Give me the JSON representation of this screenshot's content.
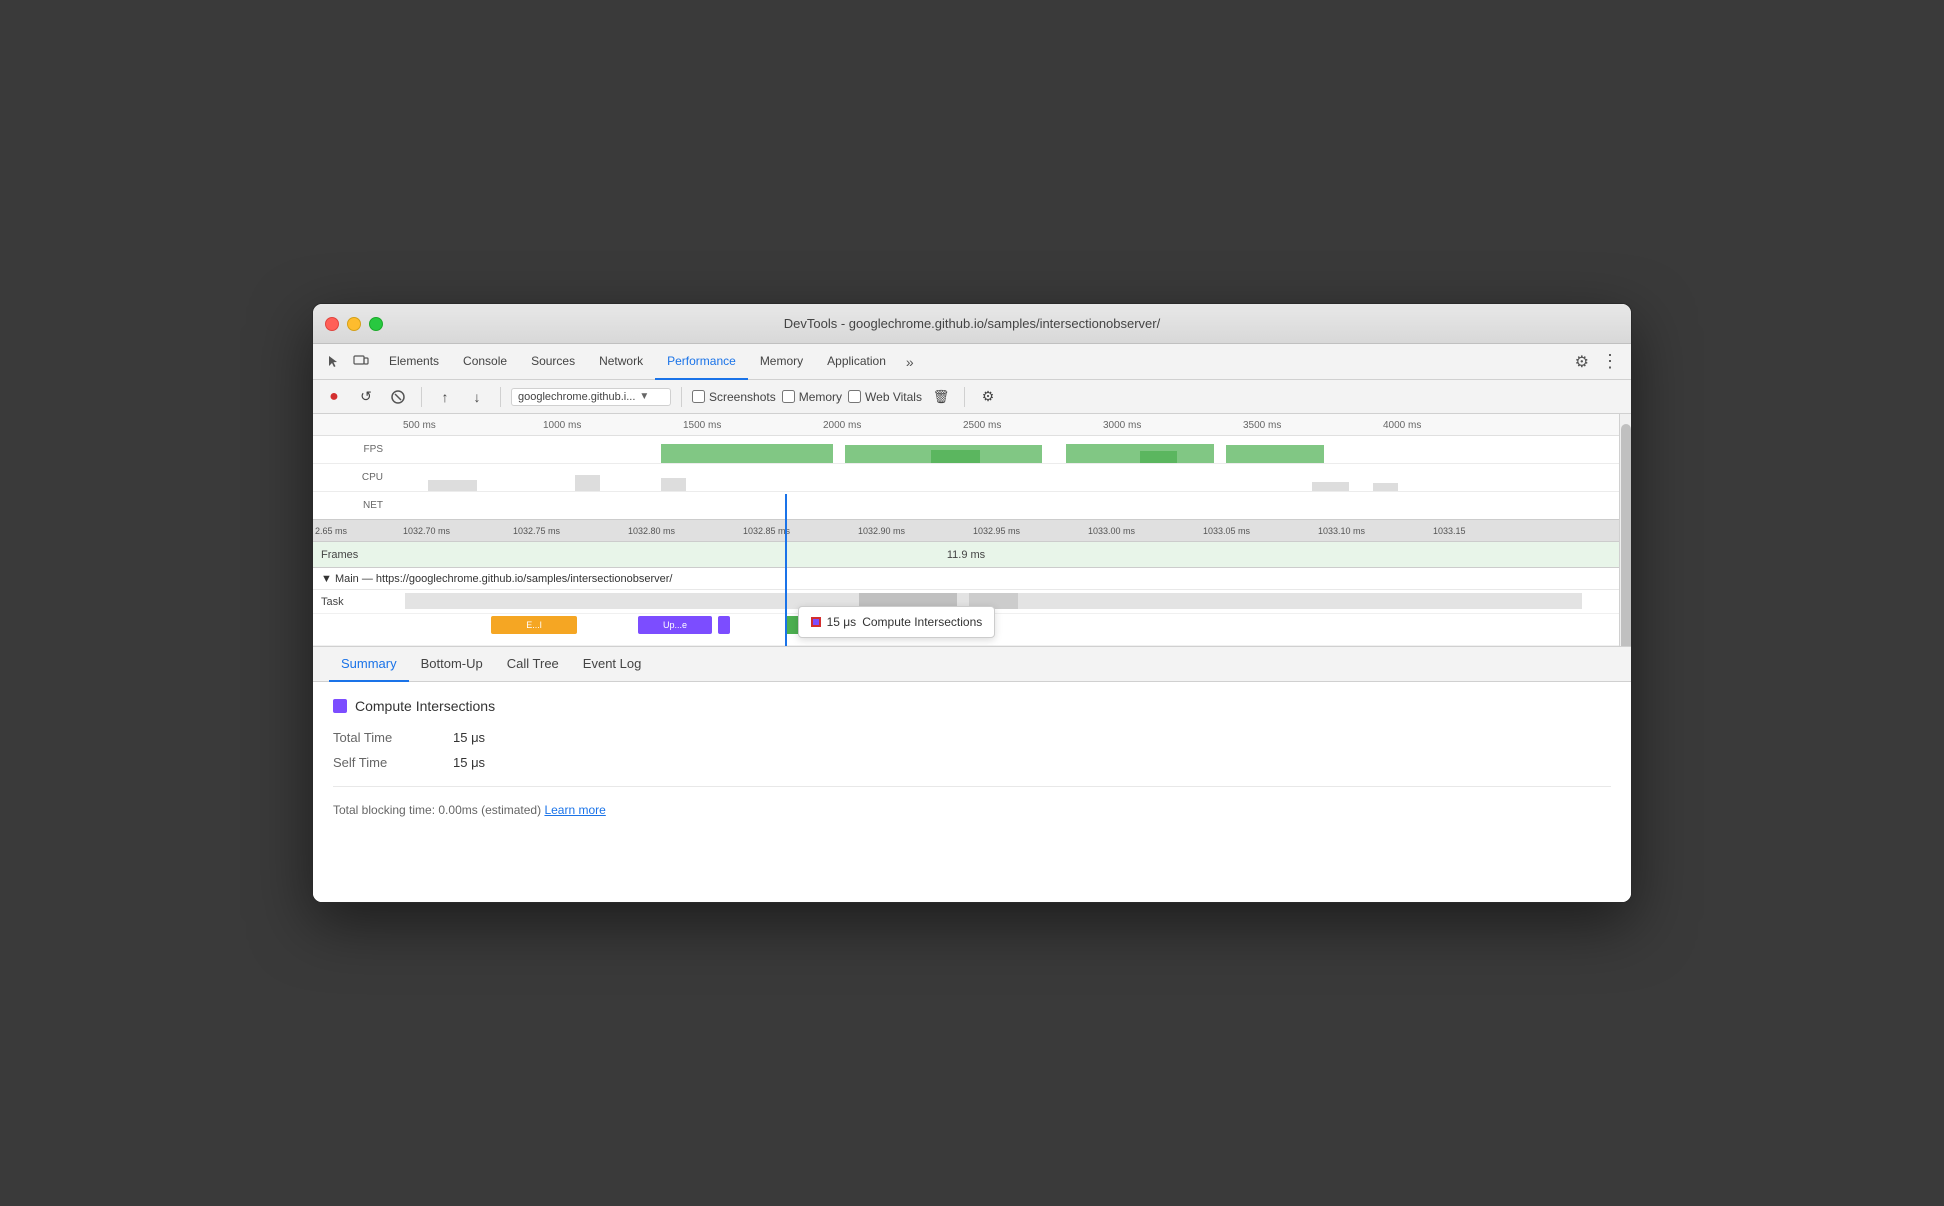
{
  "window": {
    "title": "DevTools - googlechrome.github.io/samples/intersectionobserver/"
  },
  "nav": {
    "tabs": [
      {
        "id": "elements",
        "label": "Elements",
        "active": false
      },
      {
        "id": "console",
        "label": "Console",
        "active": false
      },
      {
        "id": "sources",
        "label": "Sources",
        "active": false
      },
      {
        "id": "network",
        "label": "Network",
        "active": false
      },
      {
        "id": "performance",
        "label": "Performance",
        "active": true
      },
      {
        "id": "memory",
        "label": "Memory",
        "active": false
      },
      {
        "id": "application",
        "label": "Application",
        "active": false
      }
    ],
    "more_label": "»",
    "settings_icon": "⚙",
    "dots_icon": "⋮"
  },
  "toolbar": {
    "record_label": "●",
    "refresh_label": "↺",
    "stop_label": "⊘",
    "upload_label": "↑",
    "download_label": "↓",
    "url_text": "googlechrome.github.i...",
    "screenshots_label": "Screenshots",
    "memory_label": "Memory",
    "web_vitals_label": "Web Vitals",
    "trash_label": "🗑",
    "settings_label": "⚙"
  },
  "timeline": {
    "ruler_marks": [
      "500 ms",
      "1000 ms",
      "1500 ms",
      "2000 ms",
      "2500 ms",
      "3000 ms",
      "3500 ms",
      "4000 ms"
    ],
    "fps_label": "FPS",
    "cpu_label": "CPU",
    "net_label": "NET",
    "ms_marks": [
      "2.65 ms",
      "1032.70 ms",
      "1032.75 ms",
      "1032.80 ms",
      "1032.85 ms",
      "1032.90 ms",
      "1032.95 ms",
      "1033.00 ms",
      "1033.05 ms",
      "1033.10 ms",
      "1033.15"
    ],
    "frames_label": "Frames",
    "frames_value": "11.9 ms",
    "main_label": "▼ Main — https://googlechrome.github.io/samples/intersectionobserver/",
    "task_label": "Task",
    "task_blocks": [
      {
        "label": "E...l",
        "color": "#f5a623",
        "left": "12%",
        "width": "7%"
      },
      {
        "label": "Up...e",
        "color": "#7c4dff",
        "left": "24%",
        "width": "6%"
      },
      {
        "label": "",
        "color": "#7c4dff",
        "left": "30.5%",
        "width": "1%"
      },
      {
        "label": "Co...rs",
        "color": "#4caf50",
        "left": "36%",
        "width": "6%"
      },
      {
        "label": "",
        "color": "#888",
        "left": "44%",
        "width": "3%"
      },
      {
        "label": "",
        "color": "#aaa",
        "left": "48%",
        "width": "2%"
      }
    ],
    "tooltip": {
      "time": "15 μs",
      "label": "Compute Intersections"
    }
  },
  "bottom": {
    "tabs": [
      {
        "id": "summary",
        "label": "Summary",
        "active": true
      },
      {
        "id": "bottom-up",
        "label": "Bottom-Up",
        "active": false
      },
      {
        "id": "call-tree",
        "label": "Call Tree",
        "active": false
      },
      {
        "id": "event-log",
        "label": "Event Log",
        "active": false
      }
    ]
  },
  "summary": {
    "title": "Compute Intersections",
    "color": "#7c4dff",
    "rows": [
      {
        "label": "Total Time",
        "value": "15 μs"
      },
      {
        "label": "Self Time",
        "value": "15 μs"
      }
    ],
    "footer_text": "Total blocking time: 0.00ms (estimated)",
    "learn_more_label": "Learn more"
  }
}
